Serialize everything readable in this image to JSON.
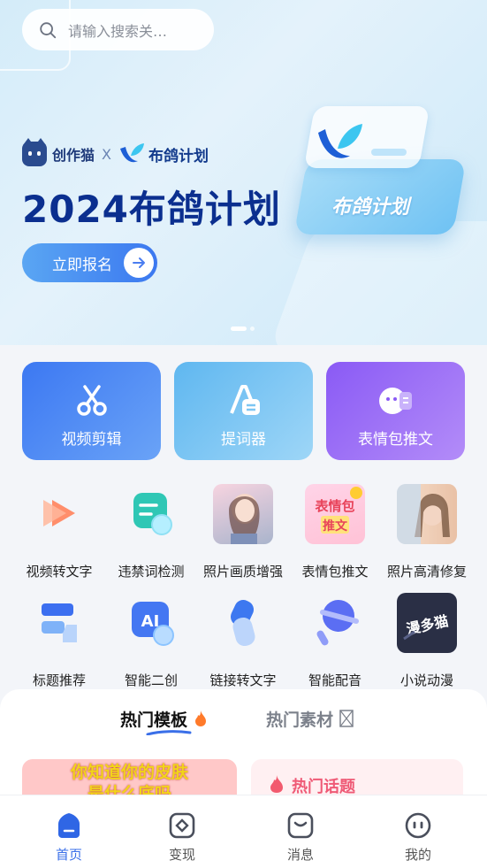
{
  "search": {
    "placeholder": "请输入搜索关…"
  },
  "banner": {
    "brand_left": "创作猫",
    "brand_sep": "X",
    "brand_right": "布鸽计划",
    "title": "2024布鸽计划",
    "cta_label": "立即报名",
    "card_label": "布鸽计划",
    "slides_total": 2,
    "slide_active": 1
  },
  "big_tools": [
    {
      "label": "视频剪辑",
      "icon": "scissors-icon"
    },
    {
      "label": "提词器",
      "icon": "teleprompter-icon"
    },
    {
      "label": "表情包推文",
      "icon": "emoji-post-icon"
    }
  ],
  "tools_row1": [
    {
      "label": "视频转文字",
      "icon": "video-to-text-icon"
    },
    {
      "label": "违禁词检测",
      "icon": "word-check-icon"
    },
    {
      "label": "照片画质增强",
      "icon": "photo-enhance-thumbnail"
    },
    {
      "label": "表情包推文",
      "icon": "meme-post-thumbnail",
      "thumb_text": "表情包推文"
    },
    {
      "label": "照片高清修复",
      "icon": "photo-restore-thumbnail"
    }
  ],
  "tools_row2": [
    {
      "label": "标题推荐",
      "icon": "title-recommend-icon"
    },
    {
      "label": "智能二创",
      "icon": "ai-create-icon",
      "badge": "AI"
    },
    {
      "label": "链接转文字",
      "icon": "link-to-text-icon"
    },
    {
      "label": "智能配音",
      "icon": "ai-dubbing-icon"
    },
    {
      "label": "小说动漫",
      "icon": "novel-anime-icon",
      "badge": "漫多猫"
    }
  ],
  "content": {
    "tab_active": "热门模板",
    "tab_inactive": "热门素材",
    "card_left_line1": "你知道你的皮肤",
    "card_left_line2": "是什么底吗",
    "card_right_title": "热门话题"
  },
  "navbar": [
    {
      "label": "首页",
      "icon": "home-icon",
      "active": true
    },
    {
      "label": "变现",
      "icon": "monetize-icon",
      "active": false
    },
    {
      "label": "消息",
      "icon": "message-icon",
      "active": false
    },
    {
      "label": "我的",
      "icon": "profile-icon",
      "active": false
    }
  ],
  "colors": {
    "accent": "#3a6fe8",
    "title": "#0b2f8f",
    "hot": "#ef5a76"
  }
}
